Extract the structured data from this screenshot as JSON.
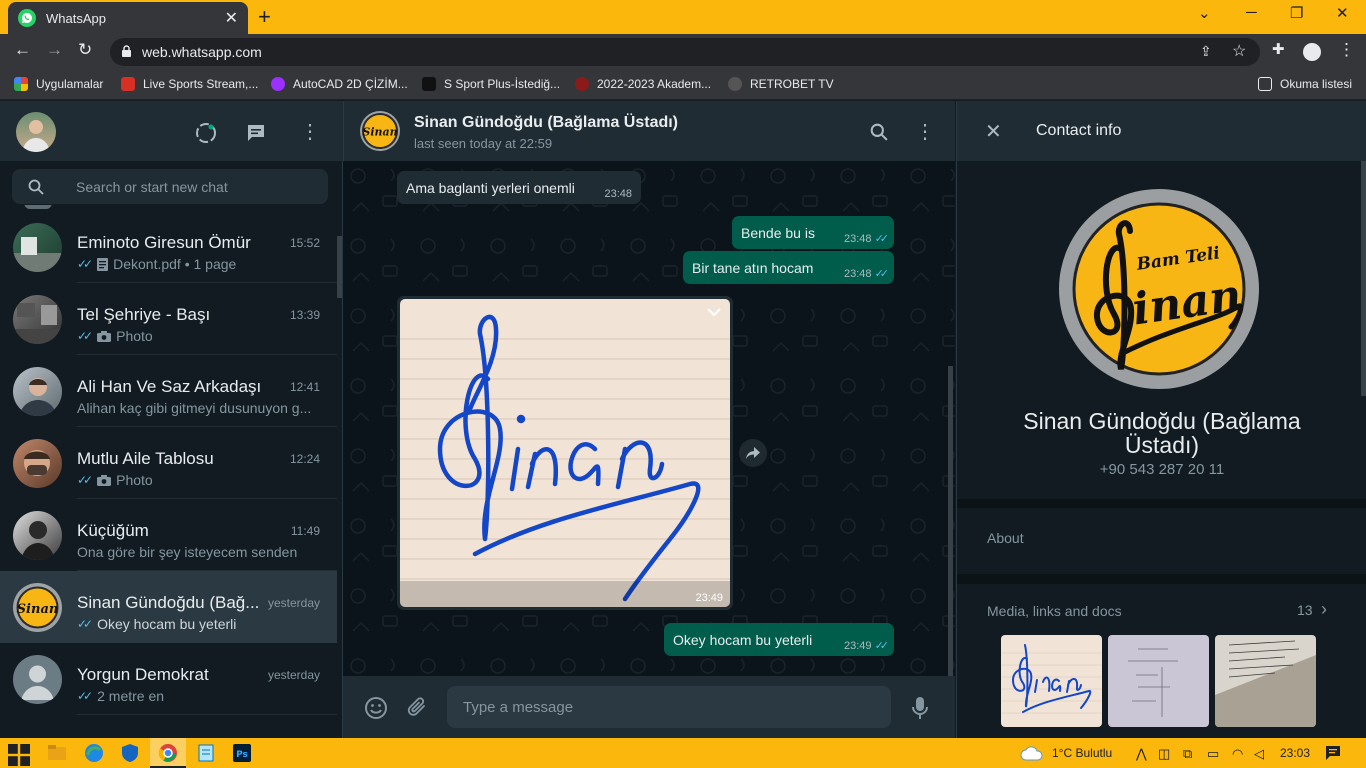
{
  "browser": {
    "tab_title": "WhatsApp",
    "url": "web.whatsapp.com",
    "bookmarks": [
      {
        "label": "Uygulamalar"
      },
      {
        "label": "Live Sports Stream,..."
      },
      {
        "label": "AutoCAD 2D ÇİZİM..."
      },
      {
        "label": "S Sport Plus-İstediğ..."
      },
      {
        "label": "2022-2023 Akadem..."
      },
      {
        "label": "RETROBET TV"
      }
    ],
    "reading_list": "Okuma listesi"
  },
  "sidebar": {
    "search_placeholder": "Search or start new chat",
    "chats": [
      {
        "name": "Eminoto Giresun Ömür",
        "time": "15:52",
        "preview": "Dekont.pdf • 1 page",
        "preview_icon": "document-icon",
        "ticks": true
      },
      {
        "name": "Tel Şehriye - Başı",
        "time": "13:39",
        "preview": "Photo",
        "preview_icon": "camera-icon",
        "ticks": true
      },
      {
        "name": "Ali Han Ve Saz Arkadaşı",
        "time": "12:41",
        "preview": "Alihan kaç gibi gitmeyi dusunuyon g...",
        "preview_icon": "",
        "ticks": false
      },
      {
        "name": "Mutlu Aile Tablosu",
        "time": "12:24",
        "preview": "Photo",
        "preview_icon": "camera-icon",
        "ticks": true
      },
      {
        "name": "Küçüğüm",
        "time": "11:49",
        "preview": "Ona göre bir şey isteyecem senden",
        "preview_icon": "",
        "ticks": false
      },
      {
        "name": "Sinan Gündoğdu (Bağ...",
        "time": "yesterday",
        "preview": "Okey hocam bu yeterli",
        "preview_icon": "",
        "ticks": true
      },
      {
        "name": "Yorgun Demokrat",
        "time": "yesterday",
        "preview": "2 metre en",
        "preview_icon": "",
        "ticks": true
      }
    ]
  },
  "conversation": {
    "name": "Sinan Gündoğdu (Bağlama Üstadı)",
    "status": "last seen today at 22:59",
    "messages": [
      {
        "dir": "in",
        "text": "Ama baglanti yerleri onemli",
        "time": "23:48"
      },
      {
        "dir": "out",
        "text": "Bende bu is",
        "time": "23:48"
      },
      {
        "dir": "out",
        "text": "Bir tane atın hocam",
        "time": "23:48"
      },
      {
        "dir": "in",
        "type": "image",
        "time": "23:49"
      },
      {
        "dir": "out",
        "text": "Okey hocam bu yeterli",
        "time": "23:49"
      }
    ],
    "composer_placeholder": "Type a message"
  },
  "contact_info": {
    "header": "Contact info",
    "logo_top": "Bam Teli",
    "logo_main": "inan",
    "name": "Sinan Gündoğdu (Bağlama Üstadı)",
    "phone": "+90 543 287 20 11",
    "about_label": "About",
    "media_label": "Media, links and docs",
    "media_count": "13"
  },
  "taskbar": {
    "weather": "1°C  Bulutlu",
    "clock": "23:03"
  },
  "colors": {
    "wa_green": "#00a884",
    "outgoing_bubble": "#005c4b",
    "incoming_bubble": "#202c33",
    "tick_blue": "#53bdeb",
    "chrome_frame": "#fbb70b"
  }
}
